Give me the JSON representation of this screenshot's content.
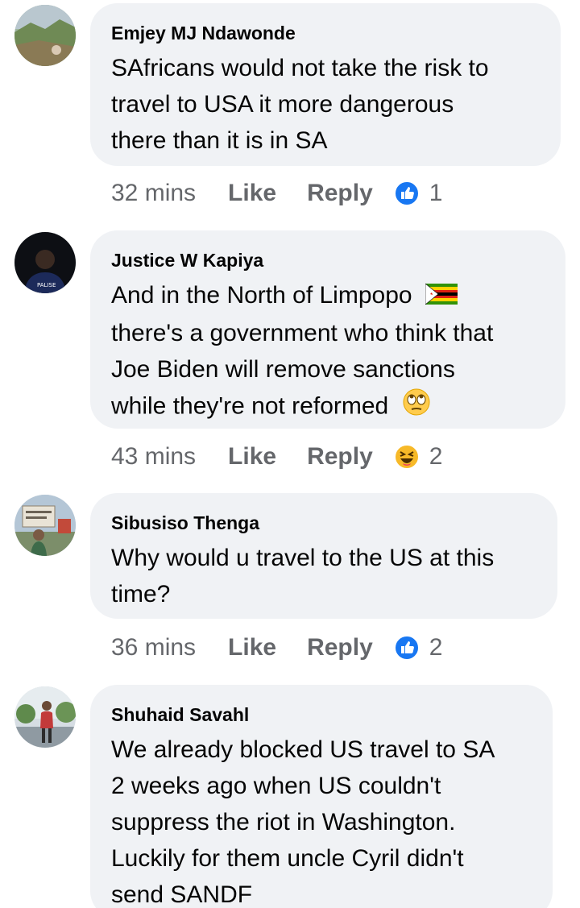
{
  "comments": [
    {
      "author": "Emjey MJ Ndawonde",
      "lines": [
        "SAfricans would not take the risk to",
        "travel to USA it more dangerous",
        "there than it is in SA"
      ],
      "time": "32 mins",
      "like_label": "Like",
      "reply_label": "Reply",
      "reaction": "like-icon",
      "reaction_count": "1",
      "avatar": "landscape-avatar"
    },
    {
      "author": "Justice W Kapiya",
      "lines": [
        "And in the North of Limpopo",
        "there's a government who think that",
        "Joe Biden will remove sanctions",
        "while they're not reformed"
      ],
      "inline_emojis": [
        "zimbabwe-flag-icon",
        "eye-roll-emoji"
      ],
      "time": "43 mins",
      "like_label": "Like",
      "reply_label": "Reply",
      "reaction": "haha-icon",
      "reaction_count": "2",
      "avatar": "person-dark-avatar"
    },
    {
      "author": "Sibusiso Thenga",
      "lines": [
        "Why would u travel to the US at this",
        "time?"
      ],
      "time": "36 mins",
      "like_label": "Like",
      "reply_label": "Reply",
      "reaction": "like-icon",
      "reaction_count": "2",
      "avatar": "sign-avatar"
    },
    {
      "author": "Shuhaid Savahl",
      "lines": [
        "We already blocked US travel to SA",
        "2 weeks ago when US couldn't",
        "suppress the riot in Washington.",
        "Luckily for them uncle Cyril didn't",
        "send SANDF"
      ],
      "avatar": "person-outdoor-avatar"
    }
  ],
  "colors": {
    "bubble": "#f0f2f5",
    "meta_text": "#65676b",
    "like_blue": "#1877f2",
    "haha_yellow": "#f7b928"
  }
}
